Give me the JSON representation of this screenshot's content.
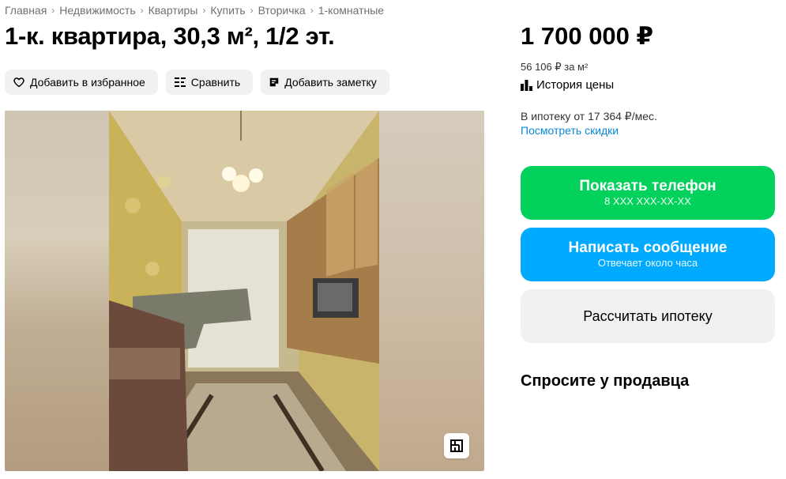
{
  "breadcrumb": [
    "Главная",
    "Недвижимость",
    "Квартиры",
    "Купить",
    "Вторичка",
    "1-комнатные"
  ],
  "title": "1-к. квартира, 30,3 м², 1/2 эт.",
  "actions": {
    "favorite": "Добавить в избранное",
    "compare": "Сравнить",
    "note": "Добавить заметку"
  },
  "gallery": {
    "plan_icon": "floor-plan-icon"
  },
  "price": {
    "total": "1 700 000 ₽",
    "per_m2": "56 106 ₽ за м²",
    "history": "История цены"
  },
  "mortgage": {
    "text": "В ипотеку от 17 364 ₽/мес.",
    "link": "Посмотреть скидки"
  },
  "buttons": {
    "phone_main": "Показать телефон",
    "phone_sub": "8 XXX XXX-XX-XX",
    "message_main": "Написать сообщение",
    "message_sub": "Отвечает около часа",
    "mortgage_calc": "Рассчитать ипотеку"
  },
  "ask_seller": "Спросите у продавца",
  "colors": {
    "phone_button": "#02d15c",
    "message_button": "#00aaff",
    "link": "#0a88d6",
    "secondary_button": "#f2f1f0"
  }
}
